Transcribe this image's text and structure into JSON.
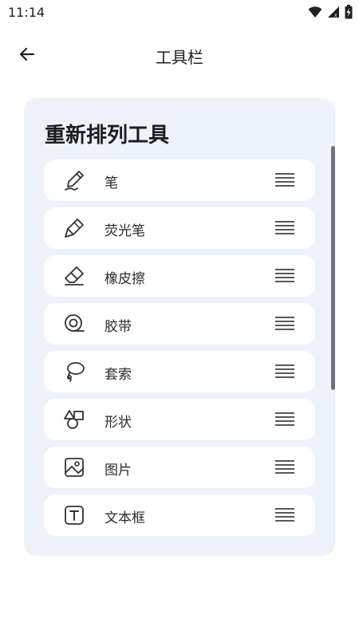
{
  "status_bar": {
    "time": "11:14",
    "icons": [
      "wifi-icon",
      "signal-icon",
      "battery-charging-icon"
    ]
  },
  "app_bar": {
    "back_icon": "back-arrow-icon",
    "title": "工具栏"
  },
  "card": {
    "title": "重新排列工具",
    "tools": [
      {
        "label": "笔",
        "icon": "pen-icon"
      },
      {
        "label": "荧光笔",
        "icon": "highlighter-icon"
      },
      {
        "label": "橡皮擦",
        "icon": "eraser-icon"
      },
      {
        "label": "胶带",
        "icon": "tape-icon"
      },
      {
        "label": "套索",
        "icon": "lasso-icon"
      },
      {
        "label": "形状",
        "icon": "shapes-icon"
      },
      {
        "label": "图片",
        "icon": "image-icon"
      },
      {
        "label": "文本框",
        "icon": "text-box-icon"
      }
    ]
  },
  "colors": {
    "card_background": "#eef3fb",
    "item_background": "#ffffff",
    "scrollbar": "#6f7378"
  }
}
